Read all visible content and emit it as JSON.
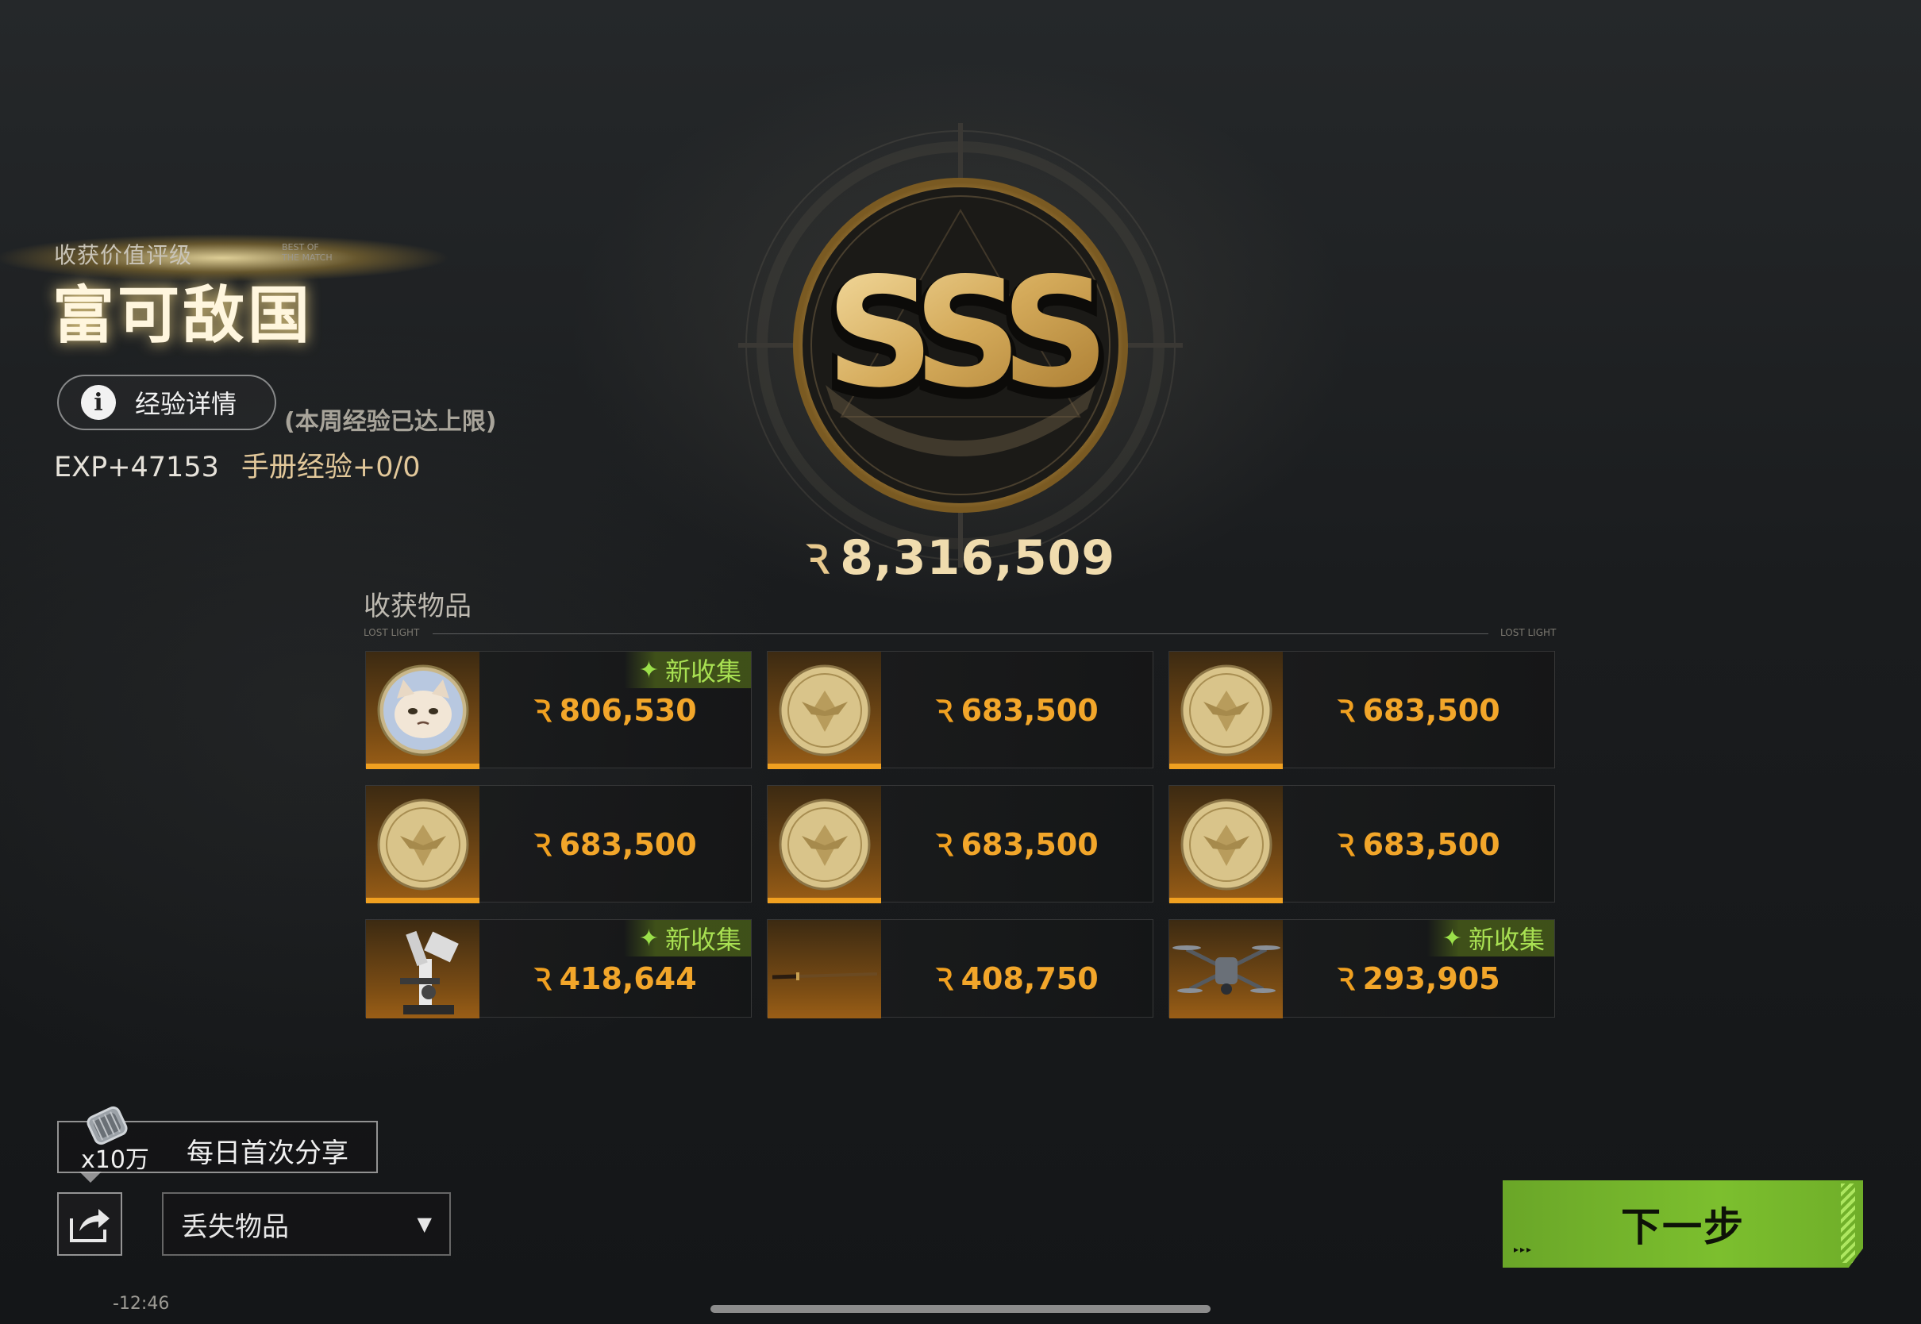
{
  "rating": {
    "label": "收获价值评级",
    "sub": "BEST OF\nTHE MATCH",
    "title": "富可敌国"
  },
  "exp": {
    "details_label": "经验详情",
    "cap_note": "(本周经验已达上限)",
    "exp_gain": "EXP+47153",
    "handbook": "手册经验+0/0"
  },
  "grade": {
    "letters": "SSS",
    "total_value": "8,316,509",
    "currency_glyph": "Ꝛ"
  },
  "collected": {
    "title": "收获物品",
    "tag_left": "LOST LIGHT",
    "tag_right": "LOST LIGHT",
    "new_label": "新收集",
    "items": [
      {
        "price": "806,530",
        "icon": "cat-coin-icon",
        "new": true
      },
      {
        "price": "683,500",
        "icon": "gold-coin-icon",
        "new": false
      },
      {
        "price": "683,500",
        "icon": "gold-coin-icon",
        "new": false
      },
      {
        "price": "683,500",
        "icon": "gold-coin-icon",
        "new": false
      },
      {
        "price": "683,500",
        "icon": "gold-coin-icon",
        "new": false
      },
      {
        "price": "683,500",
        "icon": "gold-coin-icon",
        "new": false
      },
      {
        "price": "418,644",
        "icon": "microscope-icon",
        "new": true
      },
      {
        "price": "408,750",
        "icon": "sword-icon",
        "new": false
      },
      {
        "price": "293,905",
        "icon": "drone-icon",
        "new": true
      }
    ]
  },
  "share": {
    "multiplier": "x10万",
    "promo": "每日首次分享"
  },
  "lost_items": {
    "selected": "丢失物品"
  },
  "next_button": {
    "label": "下一步"
  },
  "clock": "-12:46",
  "colors": {
    "accent_orange": "#f0a020",
    "new_green": "#a8e052",
    "next_green": "#7cbf2e",
    "gold": "#e8c98e"
  }
}
